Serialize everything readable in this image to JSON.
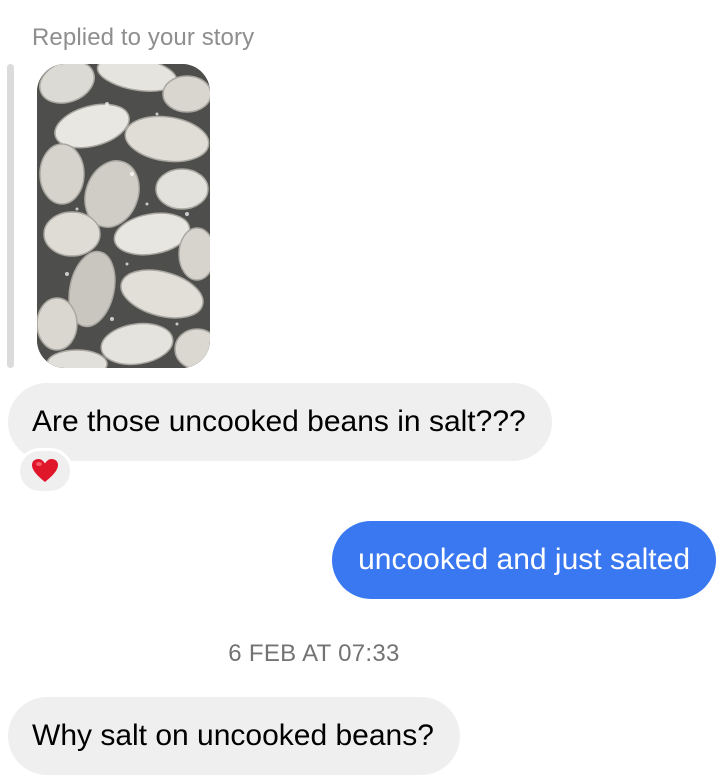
{
  "story_reply": {
    "label": "Replied to your story",
    "thumbnail_description_icon": "beans-photo"
  },
  "messages": [
    {
      "direction": "incoming",
      "text": "Are those uncooked beans in salt???",
      "reaction": "❤️"
    },
    {
      "direction": "outgoing",
      "text": "uncooked and just salted"
    },
    {
      "direction": "incoming",
      "text": "Why salt on uncooked beans?"
    }
  ],
  "timestamp": "6 FEB AT 07:33",
  "colors": {
    "outgoing_bubble": "#3a78f2",
    "incoming_bubble": "#efefef",
    "meta_text": "#8e8e8e"
  }
}
